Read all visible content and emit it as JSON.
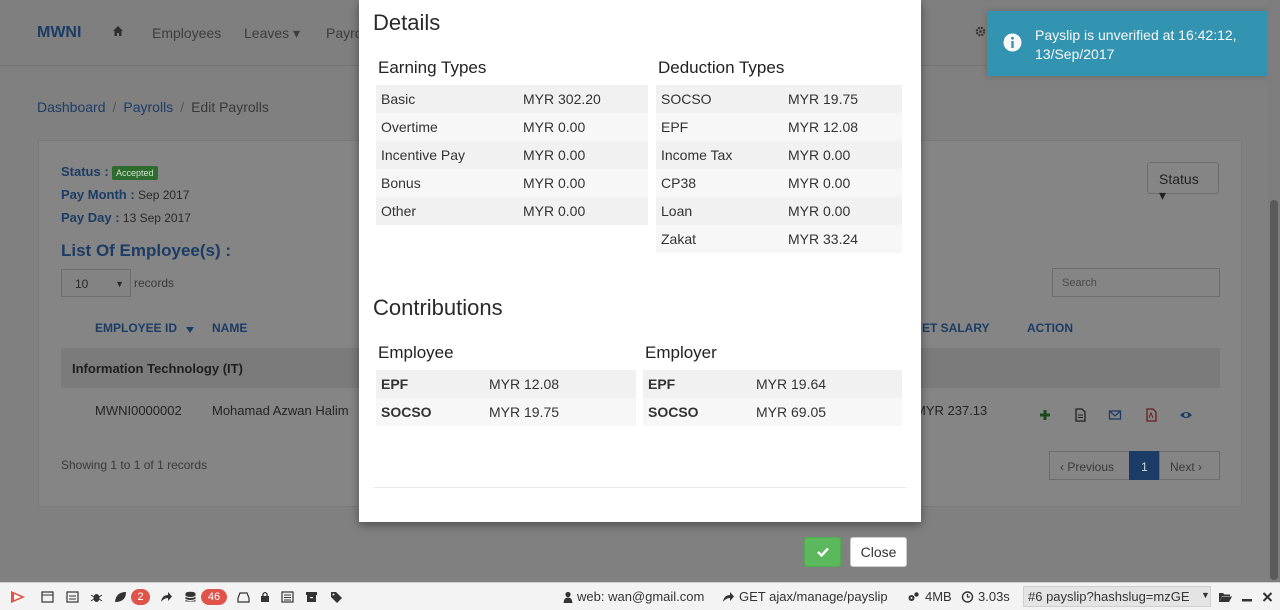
{
  "navbar": {
    "brand": "MWNI",
    "items": [
      "Employees",
      "Leaves ▾",
      "Payro"
    ]
  },
  "breadcrumb": {
    "dashboard": "Dashboard",
    "payrolls": "Payrolls",
    "current": "Edit Payrolls",
    "separator": "/"
  },
  "payroll": {
    "status_label": "Status :",
    "status_value": "Accepted",
    "pay_month_label": "Pay Month :",
    "pay_month_value": "Sep 2017",
    "pay_day_label": "Pay Day :",
    "pay_day_value": "13 Sep 2017",
    "list_title": "List Of Employee(s) :",
    "length_value": "10",
    "records_label": "records",
    "search_placeholder": "Search",
    "status_button": "Status ▾",
    "columns": {
      "employee_id": "EMPLOYEE ID",
      "name": "NAME",
      "net_salary": "ET SALARY",
      "action": "ACTION"
    },
    "group_label": "Information Technology (IT)",
    "row": {
      "employee_id": "MWNI0000002",
      "name": "Mohamad Azwan Halim",
      "net_salary": "MYR 237.13"
    },
    "showing": "Showing 1 to 1 of 1 records",
    "pager": {
      "previous": "‹  Previous",
      "page": "1",
      "next": "Next  ›"
    }
  },
  "modal": {
    "title": "Details",
    "earning_heading": "Earning Types",
    "earnings": [
      {
        "label": "Basic",
        "value": "MYR 302.20"
      },
      {
        "label": "Overtime",
        "value": "MYR 0.00"
      },
      {
        "label": "Incentive Pay",
        "value": "MYR 0.00"
      },
      {
        "label": "Bonus",
        "value": "MYR 0.00"
      },
      {
        "label": "Other",
        "value": "MYR 0.00"
      }
    ],
    "deduction_heading": "Deduction Types",
    "deductions": [
      {
        "label": "SOCSO",
        "value": "MYR 19.75"
      },
      {
        "label": "EPF",
        "value": "MYR 12.08"
      },
      {
        "label": "Income Tax",
        "value": "MYR 0.00"
      },
      {
        "label": "CP38",
        "value": "MYR 0.00"
      },
      {
        "label": "Loan",
        "value": "MYR 0.00"
      },
      {
        "label": "Zakat",
        "value": "MYR 33.24"
      }
    ],
    "contributions_title": "Contributions",
    "employee_heading": "Employee",
    "employee_contrib": [
      {
        "label": "EPF",
        "value": "MYR 12.08"
      },
      {
        "label": "SOCSO",
        "value": "MYR 19.75"
      }
    ],
    "employer_heading": "Employer",
    "employer_contrib": [
      {
        "label": "EPF",
        "value": "MYR 19.64"
      },
      {
        "label": "SOCSO",
        "value": "MYR 69.05"
      }
    ],
    "close_label": "Close"
  },
  "toast": {
    "message": "Payslip is unverified at 16:42:12, 13/Sep/2017",
    "color": "#2f96b4"
  },
  "debugbar": {
    "badge_red": "2",
    "queries_count": "46",
    "user": "web: wan@gmail.com",
    "request": "GET ajax/manage/payslip",
    "memory": "4MB",
    "time": "3.03s",
    "request_select": "#6 payslip?hashslug=mzGE"
  }
}
